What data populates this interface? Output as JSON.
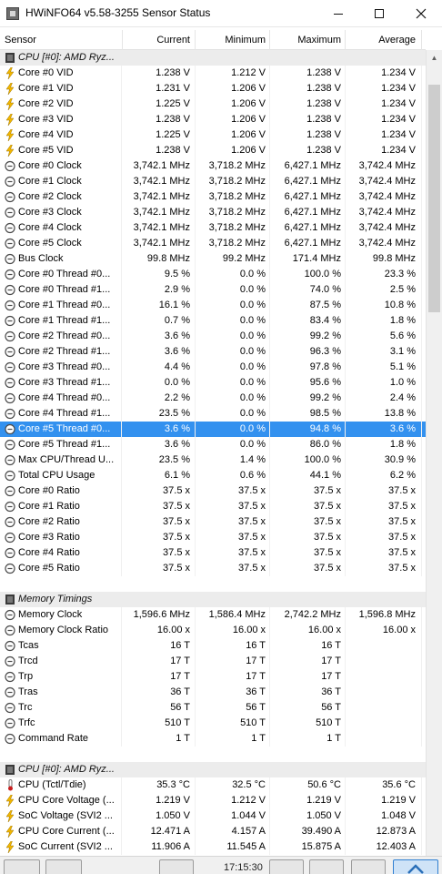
{
  "window": {
    "title": "HWiNFO64 v5.58-3255 Sensor Status"
  },
  "columns": {
    "sensor": "Sensor",
    "current": "Current",
    "minimum": "Minimum",
    "maximum": "Maximum",
    "average": "Average"
  },
  "rows": [
    {
      "type": "group",
      "name": "CPU [#0]: AMD Ryz..."
    },
    {
      "type": "data",
      "icon": "voltage",
      "name": "Core #0 VID",
      "cur": "1.238 V",
      "min": "1.212 V",
      "max": "1.238 V",
      "avg": "1.234 V"
    },
    {
      "type": "data",
      "icon": "voltage",
      "name": "Core #1 VID",
      "cur": "1.231 V",
      "min": "1.206 V",
      "max": "1.238 V",
      "avg": "1.234 V"
    },
    {
      "type": "data",
      "icon": "voltage",
      "name": "Core #2 VID",
      "cur": "1.225 V",
      "min": "1.206 V",
      "max": "1.238 V",
      "avg": "1.234 V"
    },
    {
      "type": "data",
      "icon": "voltage",
      "name": "Core #3 VID",
      "cur": "1.238 V",
      "min": "1.206 V",
      "max": "1.238 V",
      "avg": "1.234 V"
    },
    {
      "type": "data",
      "icon": "voltage",
      "name": "Core #4 VID",
      "cur": "1.225 V",
      "min": "1.206 V",
      "max": "1.238 V",
      "avg": "1.234 V"
    },
    {
      "type": "data",
      "icon": "voltage",
      "name": "Core #5 VID",
      "cur": "1.238 V",
      "min": "1.206 V",
      "max": "1.238 V",
      "avg": "1.234 V"
    },
    {
      "type": "data",
      "icon": "clock",
      "name": "Core #0 Clock",
      "cur": "3,742.1 MHz",
      "min": "3,718.2 MHz",
      "max": "6,427.1 MHz",
      "avg": "3,742.4 MHz"
    },
    {
      "type": "data",
      "icon": "clock",
      "name": "Core #1 Clock",
      "cur": "3,742.1 MHz",
      "min": "3,718.2 MHz",
      "max": "6,427.1 MHz",
      "avg": "3,742.4 MHz"
    },
    {
      "type": "data",
      "icon": "clock",
      "name": "Core #2 Clock",
      "cur": "3,742.1 MHz",
      "min": "3,718.2 MHz",
      "max": "6,427.1 MHz",
      "avg": "3,742.4 MHz"
    },
    {
      "type": "data",
      "icon": "clock",
      "name": "Core #3 Clock",
      "cur": "3,742.1 MHz",
      "min": "3,718.2 MHz",
      "max": "6,427.1 MHz",
      "avg": "3,742.4 MHz"
    },
    {
      "type": "data",
      "icon": "clock",
      "name": "Core #4 Clock",
      "cur": "3,742.1 MHz",
      "min": "3,718.2 MHz",
      "max": "6,427.1 MHz",
      "avg": "3,742.4 MHz"
    },
    {
      "type": "data",
      "icon": "clock",
      "name": "Core #5 Clock",
      "cur": "3,742.1 MHz",
      "min": "3,718.2 MHz",
      "max": "6,427.1 MHz",
      "avg": "3,742.4 MHz"
    },
    {
      "type": "data",
      "icon": "clock",
      "name": "Bus Clock",
      "cur": "99.8 MHz",
      "min": "99.2 MHz",
      "max": "171.4 MHz",
      "avg": "99.8 MHz"
    },
    {
      "type": "data",
      "icon": "clock",
      "name": "Core #0 Thread #0...",
      "cur": "9.5 %",
      "min": "0.0 %",
      "max": "100.0 %",
      "avg": "23.3 %"
    },
    {
      "type": "data",
      "icon": "clock",
      "name": "Core #0 Thread #1...",
      "cur": "2.9 %",
      "min": "0.0 %",
      "max": "74.0 %",
      "avg": "2.5 %"
    },
    {
      "type": "data",
      "icon": "clock",
      "name": "Core #1 Thread #0...",
      "cur": "16.1 %",
      "min": "0.0 %",
      "max": "87.5 %",
      "avg": "10.8 %"
    },
    {
      "type": "data",
      "icon": "clock",
      "name": "Core #1 Thread #1...",
      "cur": "0.7 %",
      "min": "0.0 %",
      "max": "83.4 %",
      "avg": "1.8 %"
    },
    {
      "type": "data",
      "icon": "clock",
      "name": "Core #2 Thread #0...",
      "cur": "3.6 %",
      "min": "0.0 %",
      "max": "99.2 %",
      "avg": "5.6 %"
    },
    {
      "type": "data",
      "icon": "clock",
      "name": "Core #2 Thread #1...",
      "cur": "3.6 %",
      "min": "0.0 %",
      "max": "96.3 %",
      "avg": "3.1 %"
    },
    {
      "type": "data",
      "icon": "clock",
      "name": "Core #3 Thread #0...",
      "cur": "4.4 %",
      "min": "0.0 %",
      "max": "97.8 %",
      "avg": "5.1 %"
    },
    {
      "type": "data",
      "icon": "clock",
      "name": "Core #3 Thread #1...",
      "cur": "0.0 %",
      "min": "0.0 %",
      "max": "95.6 %",
      "avg": "1.0 %"
    },
    {
      "type": "data",
      "icon": "clock",
      "name": "Core #4 Thread #0...",
      "cur": "2.2 %",
      "min": "0.0 %",
      "max": "99.2 %",
      "avg": "2.4 %"
    },
    {
      "type": "data",
      "icon": "clock",
      "name": "Core #4 Thread #1...",
      "cur": "23.5 %",
      "min": "0.0 %",
      "max": "98.5 %",
      "avg": "13.8 %"
    },
    {
      "type": "data",
      "icon": "clock",
      "name": "Core #5 Thread #0...",
      "cur": "3.6 %",
      "min": "0.0 %",
      "max": "94.8 %",
      "avg": "3.6 %",
      "selected": true
    },
    {
      "type": "data",
      "icon": "clock",
      "name": "Core #5 Thread #1...",
      "cur": "3.6 %",
      "min": "0.0 %",
      "max": "86.0 %",
      "avg": "1.8 %"
    },
    {
      "type": "data",
      "icon": "clock",
      "name": "Max CPU/Thread U...",
      "cur": "23.5 %",
      "min": "1.4 %",
      "max": "100.0 %",
      "avg": "30.9 %"
    },
    {
      "type": "data",
      "icon": "clock",
      "name": "Total CPU Usage",
      "cur": "6.1 %",
      "min": "0.6 %",
      "max": "44.1 %",
      "avg": "6.2 %"
    },
    {
      "type": "data",
      "icon": "clock",
      "name": "Core #0 Ratio",
      "cur": "37.5 x",
      "min": "37.5 x",
      "max": "37.5 x",
      "avg": "37.5 x"
    },
    {
      "type": "data",
      "icon": "clock",
      "name": "Core #1 Ratio",
      "cur": "37.5 x",
      "min": "37.5 x",
      "max": "37.5 x",
      "avg": "37.5 x"
    },
    {
      "type": "data",
      "icon": "clock",
      "name": "Core #2 Ratio",
      "cur": "37.5 x",
      "min": "37.5 x",
      "max": "37.5 x",
      "avg": "37.5 x"
    },
    {
      "type": "data",
      "icon": "clock",
      "name": "Core #3 Ratio",
      "cur": "37.5 x",
      "min": "37.5 x",
      "max": "37.5 x",
      "avg": "37.5 x"
    },
    {
      "type": "data",
      "icon": "clock",
      "name": "Core #4 Ratio",
      "cur": "37.5 x",
      "min": "37.5 x",
      "max": "37.5 x",
      "avg": "37.5 x"
    },
    {
      "type": "data",
      "icon": "clock",
      "name": "Core #5 Ratio",
      "cur": "37.5 x",
      "min": "37.5 x",
      "max": "37.5 x",
      "avg": "37.5 x"
    },
    {
      "type": "blank"
    },
    {
      "type": "group",
      "name": "Memory Timings"
    },
    {
      "type": "data",
      "icon": "clock",
      "name": "Memory Clock",
      "cur": "1,596.6 MHz",
      "min": "1,586.4 MHz",
      "max": "2,742.2 MHz",
      "avg": "1,596.8 MHz"
    },
    {
      "type": "data",
      "icon": "clock",
      "name": "Memory Clock Ratio",
      "cur": "16.00 x",
      "min": "16.00 x",
      "max": "16.00 x",
      "avg": "16.00 x"
    },
    {
      "type": "data",
      "icon": "clock",
      "name": "Tcas",
      "cur": "16 T",
      "min": "16 T",
      "max": "16 T",
      "avg": ""
    },
    {
      "type": "data",
      "icon": "clock",
      "name": "Trcd",
      "cur": "17 T",
      "min": "17 T",
      "max": "17 T",
      "avg": ""
    },
    {
      "type": "data",
      "icon": "clock",
      "name": "Trp",
      "cur": "17 T",
      "min": "17 T",
      "max": "17 T",
      "avg": ""
    },
    {
      "type": "data",
      "icon": "clock",
      "name": "Tras",
      "cur": "36 T",
      "min": "36 T",
      "max": "36 T",
      "avg": ""
    },
    {
      "type": "data",
      "icon": "clock",
      "name": "Trc",
      "cur": "56 T",
      "min": "56 T",
      "max": "56 T",
      "avg": ""
    },
    {
      "type": "data",
      "icon": "clock",
      "name": "Trfc",
      "cur": "510 T",
      "min": "510 T",
      "max": "510 T",
      "avg": ""
    },
    {
      "type": "data",
      "icon": "clock",
      "name": "Command Rate",
      "cur": "1 T",
      "min": "1 T",
      "max": "1 T",
      "avg": ""
    },
    {
      "type": "blank"
    },
    {
      "type": "group",
      "name": "CPU [#0]: AMD Ryz..."
    },
    {
      "type": "data",
      "icon": "thermometer",
      "name": "CPU (Tctl/Tdie)",
      "cur": "35.3 °C",
      "min": "32.5 °C",
      "max": "50.6 °C",
      "avg": "35.6 °C"
    },
    {
      "type": "data",
      "icon": "voltage",
      "name": "CPU Core Voltage (...",
      "cur": "1.219 V",
      "min": "1.212 V",
      "max": "1.219 V",
      "avg": "1.219 V"
    },
    {
      "type": "data",
      "icon": "voltage",
      "name": "SoC Voltage (SVI2 ...",
      "cur": "1.050 V",
      "min": "1.044 V",
      "max": "1.050 V",
      "avg": "1.048 V"
    },
    {
      "type": "data",
      "icon": "voltage",
      "name": "CPU Core Current (...",
      "cur": "12.471 A",
      "min": "4.157 A",
      "max": "39.490 A",
      "avg": "12.873 A"
    },
    {
      "type": "data",
      "icon": "voltage",
      "name": "SoC Current (SVI2 ...",
      "cur": "11.906 A",
      "min": "11.545 A",
      "max": "15.875 A",
      "avg": "12.403 A"
    }
  ],
  "toolbar": {
    "time": "17:15:30"
  },
  "colors": {
    "selection": "#3391ef",
    "group_background": "#ececec",
    "voltage_icon": "#f2b600",
    "clock_icon": "#4a4a4a"
  }
}
